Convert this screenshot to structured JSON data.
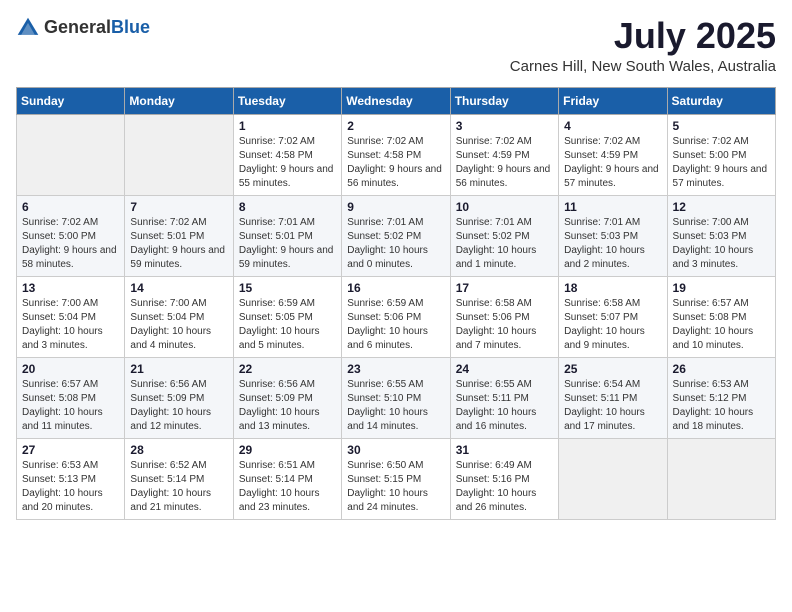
{
  "logo": {
    "text_general": "General",
    "text_blue": "Blue"
  },
  "header": {
    "month": "July 2025",
    "location": "Carnes Hill, New South Wales, Australia"
  },
  "weekdays": [
    "Sunday",
    "Monday",
    "Tuesday",
    "Wednesday",
    "Thursday",
    "Friday",
    "Saturday"
  ],
  "weeks": [
    [
      {
        "day": "",
        "info": ""
      },
      {
        "day": "",
        "info": ""
      },
      {
        "day": "1",
        "info": "Sunrise: 7:02 AM\nSunset: 4:58 PM\nDaylight: 9 hours and 55 minutes."
      },
      {
        "day": "2",
        "info": "Sunrise: 7:02 AM\nSunset: 4:58 PM\nDaylight: 9 hours and 56 minutes."
      },
      {
        "day": "3",
        "info": "Sunrise: 7:02 AM\nSunset: 4:59 PM\nDaylight: 9 hours and 56 minutes."
      },
      {
        "day": "4",
        "info": "Sunrise: 7:02 AM\nSunset: 4:59 PM\nDaylight: 9 hours and 57 minutes."
      },
      {
        "day": "5",
        "info": "Sunrise: 7:02 AM\nSunset: 5:00 PM\nDaylight: 9 hours and 57 minutes."
      }
    ],
    [
      {
        "day": "6",
        "info": "Sunrise: 7:02 AM\nSunset: 5:00 PM\nDaylight: 9 hours and 58 minutes."
      },
      {
        "day": "7",
        "info": "Sunrise: 7:02 AM\nSunset: 5:01 PM\nDaylight: 9 hours and 59 minutes."
      },
      {
        "day": "8",
        "info": "Sunrise: 7:01 AM\nSunset: 5:01 PM\nDaylight: 9 hours and 59 minutes."
      },
      {
        "day": "9",
        "info": "Sunrise: 7:01 AM\nSunset: 5:02 PM\nDaylight: 10 hours and 0 minutes."
      },
      {
        "day": "10",
        "info": "Sunrise: 7:01 AM\nSunset: 5:02 PM\nDaylight: 10 hours and 1 minute."
      },
      {
        "day": "11",
        "info": "Sunrise: 7:01 AM\nSunset: 5:03 PM\nDaylight: 10 hours and 2 minutes."
      },
      {
        "day": "12",
        "info": "Sunrise: 7:00 AM\nSunset: 5:03 PM\nDaylight: 10 hours and 3 minutes."
      }
    ],
    [
      {
        "day": "13",
        "info": "Sunrise: 7:00 AM\nSunset: 5:04 PM\nDaylight: 10 hours and 3 minutes."
      },
      {
        "day": "14",
        "info": "Sunrise: 7:00 AM\nSunset: 5:04 PM\nDaylight: 10 hours and 4 minutes."
      },
      {
        "day": "15",
        "info": "Sunrise: 6:59 AM\nSunset: 5:05 PM\nDaylight: 10 hours and 5 minutes."
      },
      {
        "day": "16",
        "info": "Sunrise: 6:59 AM\nSunset: 5:06 PM\nDaylight: 10 hours and 6 minutes."
      },
      {
        "day": "17",
        "info": "Sunrise: 6:58 AM\nSunset: 5:06 PM\nDaylight: 10 hours and 7 minutes."
      },
      {
        "day": "18",
        "info": "Sunrise: 6:58 AM\nSunset: 5:07 PM\nDaylight: 10 hours and 9 minutes."
      },
      {
        "day": "19",
        "info": "Sunrise: 6:57 AM\nSunset: 5:08 PM\nDaylight: 10 hours and 10 minutes."
      }
    ],
    [
      {
        "day": "20",
        "info": "Sunrise: 6:57 AM\nSunset: 5:08 PM\nDaylight: 10 hours and 11 minutes."
      },
      {
        "day": "21",
        "info": "Sunrise: 6:56 AM\nSunset: 5:09 PM\nDaylight: 10 hours and 12 minutes."
      },
      {
        "day": "22",
        "info": "Sunrise: 6:56 AM\nSunset: 5:09 PM\nDaylight: 10 hours and 13 minutes."
      },
      {
        "day": "23",
        "info": "Sunrise: 6:55 AM\nSunset: 5:10 PM\nDaylight: 10 hours and 14 minutes."
      },
      {
        "day": "24",
        "info": "Sunrise: 6:55 AM\nSunset: 5:11 PM\nDaylight: 10 hours and 16 minutes."
      },
      {
        "day": "25",
        "info": "Sunrise: 6:54 AM\nSunset: 5:11 PM\nDaylight: 10 hours and 17 minutes."
      },
      {
        "day": "26",
        "info": "Sunrise: 6:53 AM\nSunset: 5:12 PM\nDaylight: 10 hours and 18 minutes."
      }
    ],
    [
      {
        "day": "27",
        "info": "Sunrise: 6:53 AM\nSunset: 5:13 PM\nDaylight: 10 hours and 20 minutes."
      },
      {
        "day": "28",
        "info": "Sunrise: 6:52 AM\nSunset: 5:14 PM\nDaylight: 10 hours and 21 minutes."
      },
      {
        "day": "29",
        "info": "Sunrise: 6:51 AM\nSunset: 5:14 PM\nDaylight: 10 hours and 23 minutes."
      },
      {
        "day": "30",
        "info": "Sunrise: 6:50 AM\nSunset: 5:15 PM\nDaylight: 10 hours and 24 minutes."
      },
      {
        "day": "31",
        "info": "Sunrise: 6:49 AM\nSunset: 5:16 PM\nDaylight: 10 hours and 26 minutes."
      },
      {
        "day": "",
        "info": ""
      },
      {
        "day": "",
        "info": ""
      }
    ]
  ]
}
